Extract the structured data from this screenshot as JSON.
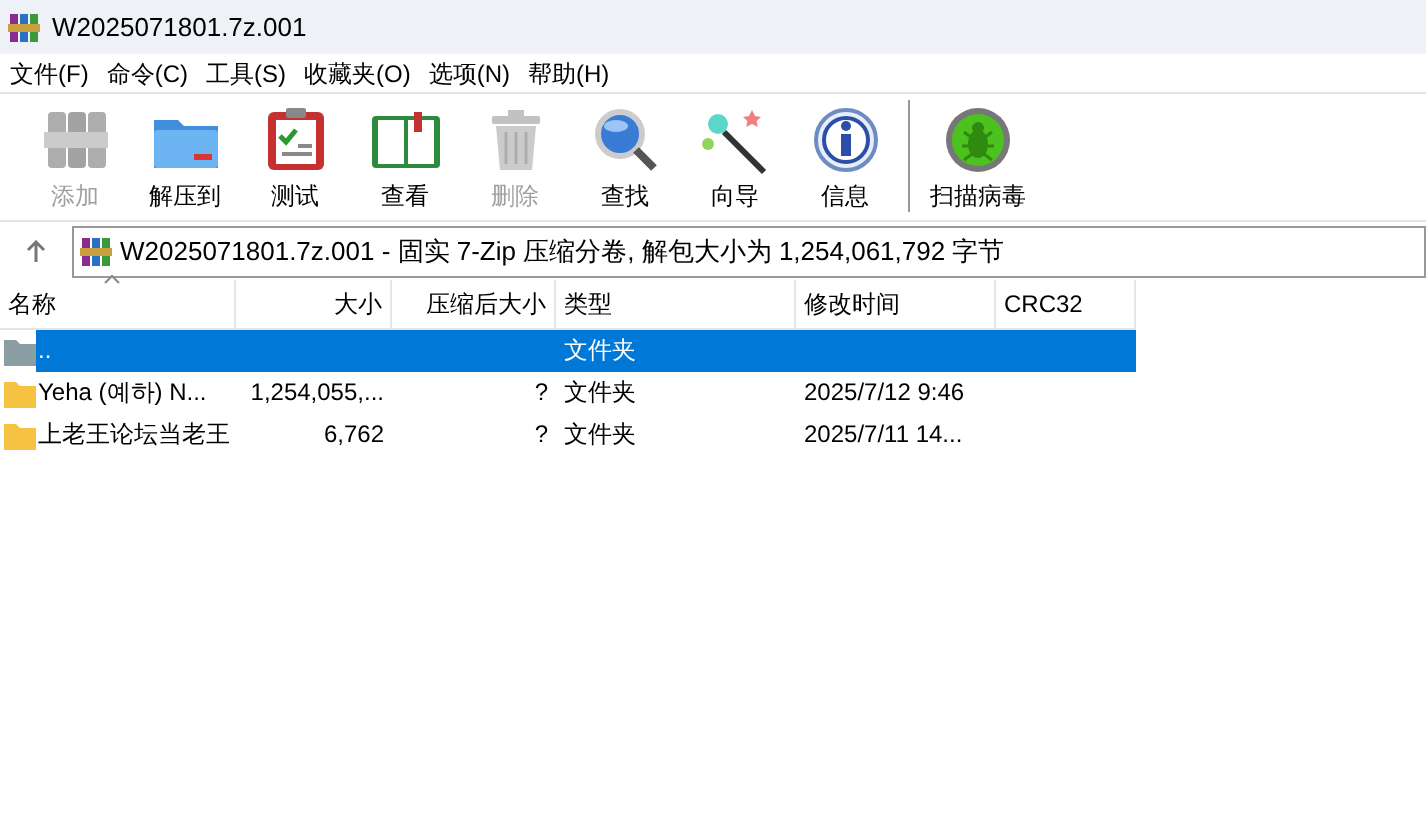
{
  "window": {
    "title": "W2025071801.7z.001"
  },
  "menu": [
    "文件(F)",
    "命令(C)",
    "工具(S)",
    "收藏夹(O)",
    "选项(N)",
    "帮助(H)"
  ],
  "toolbar": [
    {
      "kind": "archive",
      "label": "添加",
      "disabled": true
    },
    {
      "kind": "extract",
      "label": "解压到",
      "disabled": false
    },
    {
      "kind": "test",
      "label": "测试",
      "disabled": false
    },
    {
      "kind": "view",
      "label": "查看",
      "disabled": false
    },
    {
      "kind": "delete",
      "label": "删除",
      "disabled": true
    },
    {
      "kind": "find",
      "label": "查找",
      "disabled": false
    },
    {
      "kind": "wizard",
      "label": "向导",
      "disabled": false
    },
    {
      "kind": "info",
      "label": "信息",
      "disabled": false
    },
    {
      "kind": "virus",
      "label": "扫描病毒",
      "disabled": false
    }
  ],
  "address": "W2025071801.7z.001 - 固实 7-Zip 压缩分卷, 解包大小为 1,254,061,792 字节",
  "columns": [
    {
      "label": "名称",
      "sorted": true
    },
    {
      "label": "大小",
      "sorted": false
    },
    {
      "label": "压缩后大小",
      "sorted": false
    },
    {
      "label": "类型",
      "sorted": false
    },
    {
      "label": "修改时间",
      "sorted": false
    },
    {
      "label": "CRC32",
      "sorted": false
    }
  ],
  "rows": [
    {
      "kind": "parent",
      "name": "..",
      "type": "文件夹",
      "selected": true
    },
    {
      "kind": "folder",
      "name": "Yeha (예하) N...",
      "size": "1,254,055,...",
      "packed": "?",
      "type": "文件夹",
      "modified": "2025/7/12 9:46",
      "selected": false
    },
    {
      "kind": "folder",
      "name": "上老王论坛当老王",
      "size": "6,762",
      "packed": "?",
      "type": "文件夹",
      "modified": "2025/7/11 14...",
      "selected": false
    }
  ]
}
